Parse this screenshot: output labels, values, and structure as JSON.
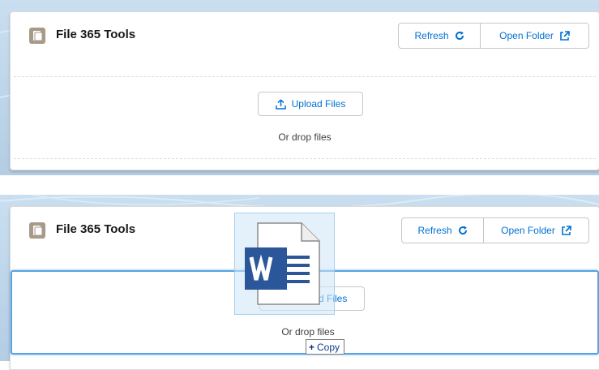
{
  "panels": [
    {
      "title": "File 365 Tools",
      "refresh_label": "Refresh",
      "open_folder_label": "Open Folder",
      "upload_label": "Upload Files",
      "drop_text": "Or drop files"
    },
    {
      "title": "File 365 Tools",
      "refresh_label": "Refresh",
      "open_folder_label": "Open Folder",
      "upload_label": "Upload Files",
      "drop_text": "Or drop files"
    }
  ],
  "drag": {
    "file_icon": "word-document-icon",
    "copy_label": "Copy"
  },
  "colors": {
    "brand_blue": "#0070d2",
    "app_icon": "#a89a88",
    "word_blue": "#2b579a",
    "drop_highlight": "#55a3e0"
  }
}
